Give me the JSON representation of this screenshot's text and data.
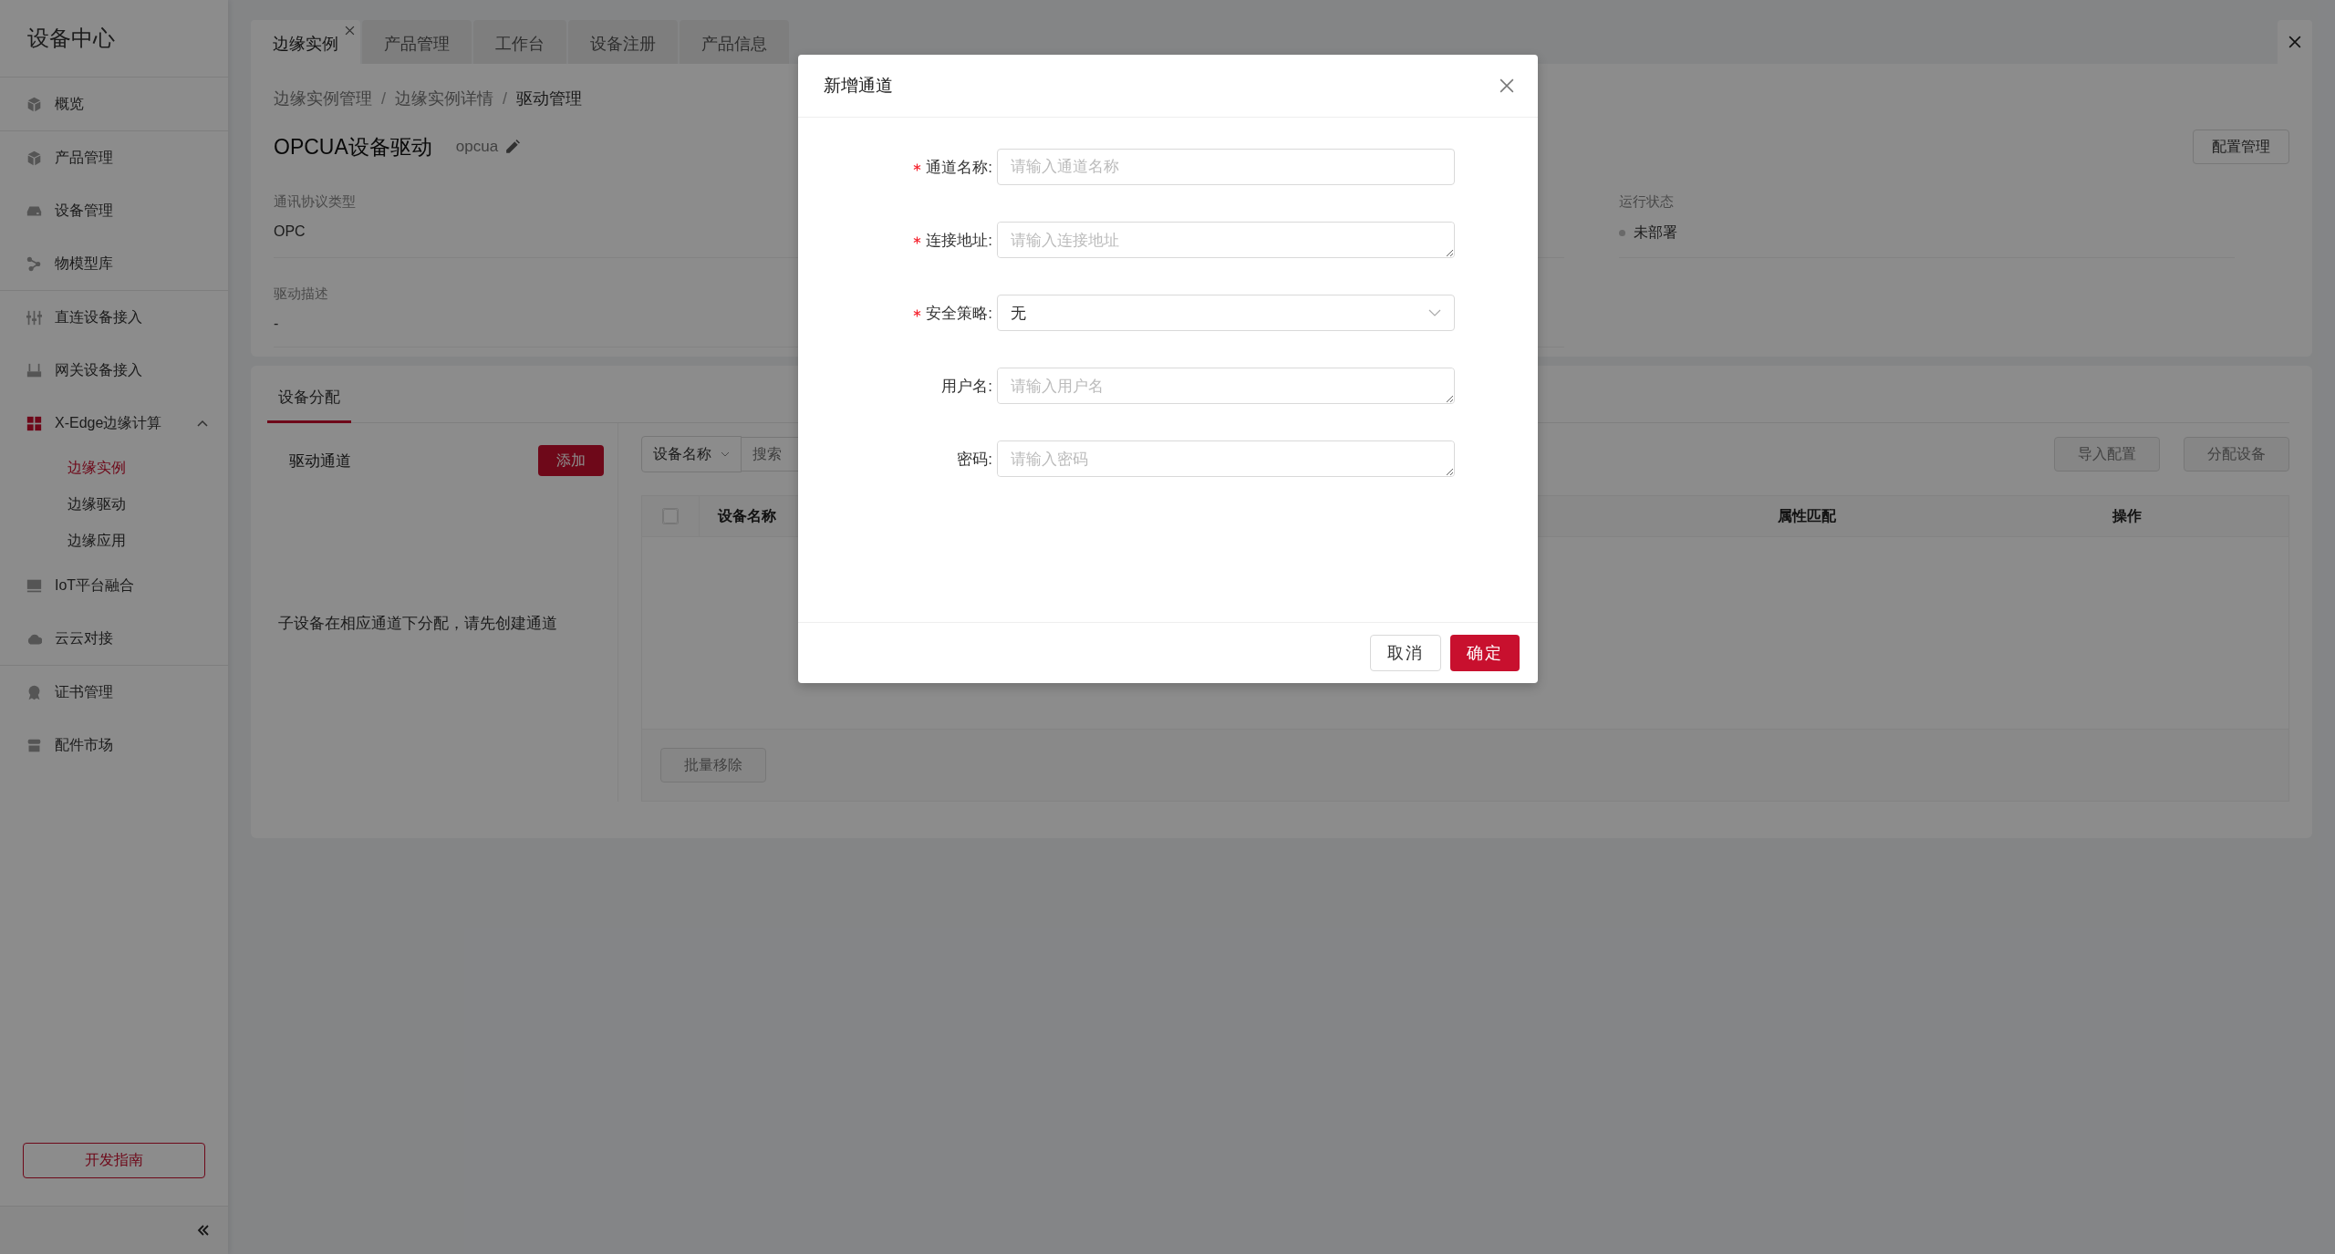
{
  "sidebar": {
    "title": "设备中心",
    "groups": [
      [
        {
          "label": "概览",
          "selected": false
        }
      ],
      [
        {
          "label": "产品管理",
          "selected": false
        },
        {
          "label": "设备管理",
          "selected": false
        },
        {
          "label": "物模型库",
          "selected": false
        }
      ],
      [
        {
          "label": "直连设备接入",
          "selected": false
        },
        {
          "label": "网关设备接入",
          "selected": false
        },
        {
          "label": "X-Edge边缘计算",
          "selected": false,
          "expanded": true,
          "children": [
            {
              "label": "边缘实例",
              "selected": true
            },
            {
              "label": "边缘驱动",
              "selected": false
            },
            {
              "label": "边缘应用",
              "selected": false
            }
          ]
        },
        {
          "label": "IoT平台融合",
          "selected": false
        },
        {
          "label": "云云对接",
          "selected": false
        }
      ],
      [
        {
          "label": "证书管理",
          "selected": false
        },
        {
          "label": "配件市场",
          "selected": false
        }
      ]
    ],
    "guide_button": "开发指南"
  },
  "tabs": [
    {
      "label": "边缘实例",
      "selected": true,
      "closable": true
    },
    {
      "label": "产品管理",
      "selected": false,
      "closable": false
    },
    {
      "label": "工作台",
      "selected": false,
      "closable": false
    },
    {
      "label": "设备注册",
      "selected": false,
      "closable": false
    },
    {
      "label": "产品信息",
      "selected": false,
      "closable": false
    }
  ],
  "breadcrumb": {
    "separator": "/",
    "items": [
      "边缘实例管理",
      "边缘实例详情",
      "驱动管理"
    ]
  },
  "driver": {
    "title": "OPCUA设备驱动",
    "code": "opcua",
    "config_button": "配置管理",
    "fields": [
      {
        "label": "通讯协议类型",
        "value": "OPC"
      },
      {
        "label": "运行状态",
        "value": "未部署"
      },
      {
        "label": "驱动描述",
        "value": "-"
      }
    ]
  },
  "assignment": {
    "tab": "设备分配",
    "channels_label": "驱动通道",
    "add_button": "添加",
    "empty_text": "子设备在相应通道下分配，请先创建通道",
    "filter_select": "设备名称",
    "search_placeholder": "搜索",
    "buttons": [
      "导入配置",
      "分配设备"
    ],
    "select_all_checked": false,
    "columns": [
      "设备名称",
      "属性匹配",
      "操作"
    ],
    "remove_button": "批量移除"
  },
  "dialog": {
    "title": "新增通道",
    "fields": [
      {
        "kind": "input",
        "label": "通道名称:",
        "required": true,
        "placeholder": "请输入通道名称"
      },
      {
        "kind": "textarea",
        "label": "连接地址:",
        "required": true,
        "placeholder": "请输入连接地址"
      },
      {
        "kind": "select",
        "label": "安全策略:",
        "required": true,
        "value": "无"
      },
      {
        "kind": "textarea",
        "label": "用户名:",
        "required": false,
        "placeholder": "请输入用户名"
      },
      {
        "kind": "textarea",
        "label": "密码:",
        "required": false,
        "placeholder": "请输入密码"
      }
    ],
    "cancel_button": "取消",
    "ok_button": "确定"
  }
}
